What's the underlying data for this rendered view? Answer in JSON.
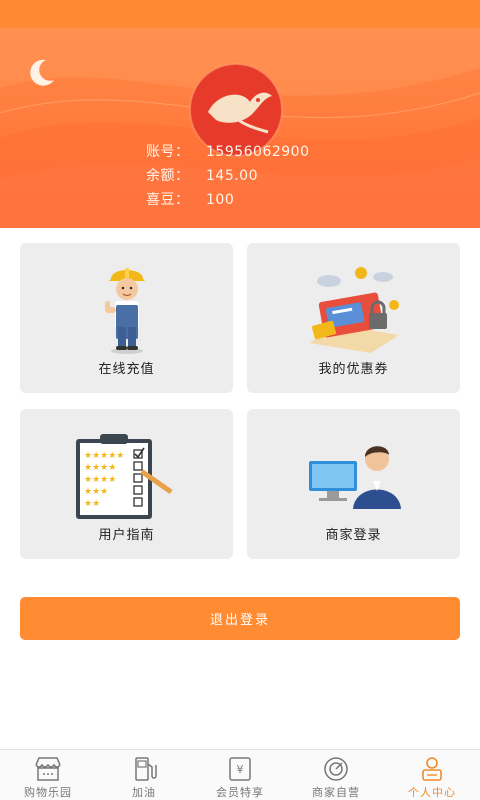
{
  "account": {
    "rows": [
      {
        "label": "账号：",
        "value": "15956062900"
      },
      {
        "label": "余额：",
        "value": "145.00"
      },
      {
        "label": "喜豆：",
        "value": "100"
      }
    ]
  },
  "cards": {
    "recharge": {
      "label": "在线充值",
      "icon": "worker-thumbs-up-icon"
    },
    "coupons": {
      "label": "我的优惠券",
      "icon": "coupons-illustration-icon"
    },
    "guide": {
      "label": "用户指南",
      "icon": "clipboard-checklist-icon"
    },
    "merchant": {
      "label": "商家登录",
      "icon": "user-computer-icon"
    }
  },
  "logout": {
    "label": "退出登录"
  },
  "tabs": [
    {
      "label": "购物乐园",
      "icon": "shop-icon"
    },
    {
      "label": "加油",
      "icon": "fuel-pump-icon"
    },
    {
      "label": "会员特享",
      "icon": "yen-card-icon"
    },
    {
      "label": "商家自营",
      "icon": "target-icon"
    },
    {
      "label": "个人中心",
      "icon": "person-icon",
      "active": true
    }
  ],
  "colors": {
    "accent": "#ff8b32",
    "active_tab": "#f08a2c",
    "card_bg": "#ededed"
  }
}
